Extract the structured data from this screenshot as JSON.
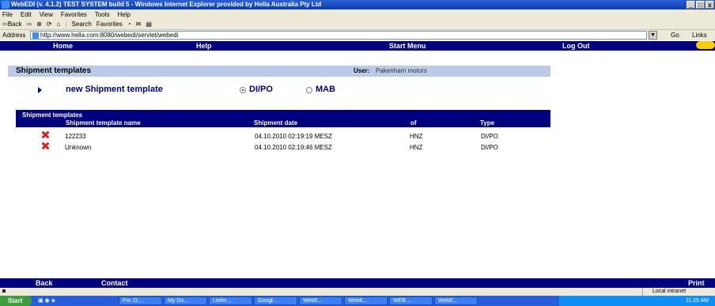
{
  "window": {
    "title": "WebEDI (v. 4.1.2) TEST SYSTEM build 5 - Windows Internet Explorer provided by Hella Australia Pty Ltd"
  },
  "menu": [
    "File",
    "Edit",
    "View",
    "Favorites",
    "Tools",
    "Help"
  ],
  "toolbar": {
    "back": "⇦Back",
    "forward": "⇨",
    "search": "Search",
    "favorites": "Favorites"
  },
  "address": {
    "label": "Address",
    "url": "http://www.hella.com:8080/webedi/servlet/webedi",
    "go": "Go",
    "links": "Links"
  },
  "nav": {
    "home": "Home",
    "help": "Help",
    "start_menu": "Start Menu",
    "logout": "Log Out"
  },
  "page": {
    "title": "Shipment templates",
    "user_label": "User:",
    "user_value": "Pakenham motors",
    "new_template": "new Shipment template",
    "radio_dipo": "DI/PO",
    "radio_mab": "MAB"
  },
  "table": {
    "title": "Shipment templates",
    "columns": [
      "Shipment template name",
      "Shipment date",
      "of",
      "Type"
    ],
    "rows": [
      [
        "122233",
        "04.10.2010 02:19:19 MESZ",
        "HNZ",
        "DI/PO"
      ],
      [
        "Unknown",
        "04.10.2010 02:19:46 MESZ",
        "HNZ",
        "DI/PO"
      ]
    ]
  },
  "footer": {
    "back": "Back",
    "contact": "Contact",
    "print": "Print"
  },
  "status": {
    "zone": "Local intranet"
  },
  "taskbar": {
    "start": "Start",
    "tasks": [
      "Fw: O...",
      "My Do...",
      "Liefer...",
      "Googl...",
      "WebE...",
      "WebE...",
      "WEB ...",
      "WebE..."
    ],
    "clock": "11:25 AM"
  }
}
